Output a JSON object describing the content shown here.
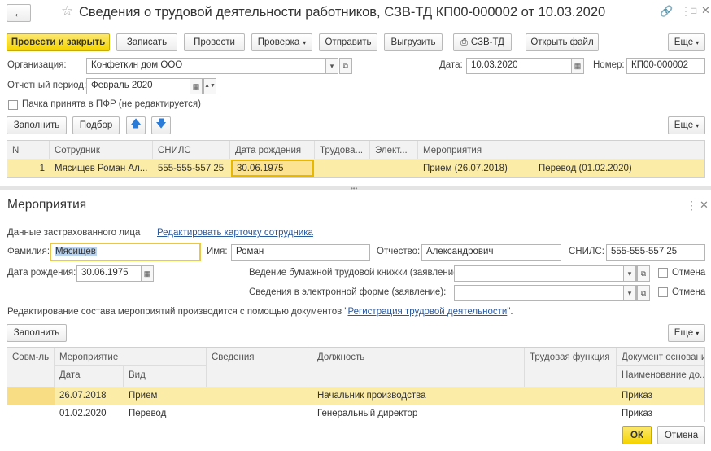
{
  "window": {
    "title": "Сведения о трудовой деятельности работников, СЗВ-ТД КП00-000002 от 10.03.2020"
  },
  "toolbar": {
    "post_close": "Провести и закрыть",
    "save": "Записать",
    "post": "Провести",
    "check": "Проверка",
    "send": "Отправить",
    "upload": "Выгрузить",
    "print": "СЗВ-ТД",
    "open_file": "Открыть файл",
    "more": "Еще"
  },
  "header_form": {
    "org_label": "Организация:",
    "org_value": "Конфеткин дом ООО",
    "date_label": "Дата:",
    "date_value": "10.03.2020",
    "number_label": "Номер:",
    "number_value": "КП00-000002",
    "period_label": "Отчетный период:",
    "period_value": "Февраль 2020",
    "accepted_label": "Пачка принята в ПФР (не редактируется)"
  },
  "table_toolbar": {
    "fill": "Заполнить",
    "select": "Подбор",
    "more": "Еще"
  },
  "main_table": {
    "columns": [
      "N",
      "Сотрудник",
      "СНИЛС",
      "Дата рождения",
      "Трудова...",
      "Элект...",
      "Мероприятия"
    ],
    "rows": [
      {
        "n": "1",
        "employee": "Мясищев Роман Ал...",
        "snils": "555-555-557 25",
        "birth": "30.06.1975",
        "labor": "",
        "elect": "",
        "event1": "Прием (26.07.2018)",
        "event2": "Перевод (01.02.2020)"
      }
    ]
  },
  "dialog": {
    "title": "Мероприятия",
    "insured_label": "Данные застрахованного лица",
    "edit_card_link": "Редактировать карточку сотрудника",
    "surname_label": "Фамилия:",
    "surname_value": "Мясищев",
    "name_label": "Имя:",
    "name_value": "Роман",
    "patronymic_label": "Отчество:",
    "patronymic_value": "Александрович",
    "snils_label": "СНИЛС:",
    "snils_value": "555-555-557 25",
    "birth_label": "Дата рождения:",
    "birth_value": "30.06.1975",
    "paper_book_label": "Ведение бумажной трудовой книжки (заявление):",
    "electronic_label": "Сведения в электронной форме (заявление):",
    "cancel_label": "Отмена",
    "info_text": "Редактирование состава мероприятий производится с помощью документов \"",
    "info_link": "Регистрация трудовой деятельности",
    "info_end": "\".",
    "fill": "Заполнить",
    "more": "Еще",
    "ok": "ОК",
    "cancel": "Отмена"
  },
  "events_table": {
    "col_combined": "Совм-ль",
    "col_event": "Мероприятие",
    "col_date": "Дата",
    "col_type": "Вид",
    "col_info": "Сведения",
    "col_position": "Должность",
    "col_function": "Трудовая функция",
    "col_doc": "Документ основание",
    "col_doc_name": "Наименование до...",
    "rows": [
      {
        "date": "26.07.2018",
        "type": "Прием",
        "position": "Начальник производства",
        "doc": "Приказ"
      },
      {
        "date": "01.02.2020",
        "type": "Перевод",
        "position": "Генеральный директор",
        "doc": "Приказ"
      }
    ]
  }
}
